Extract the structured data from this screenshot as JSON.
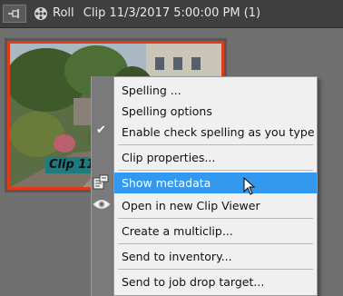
{
  "window": {
    "tab": "Roll",
    "clip_title": "Clip 11/3/2017 5:00:00 PM (1)"
  },
  "clip": {
    "caption": "Clip 11/3"
  },
  "context_menu": {
    "items": [
      {
        "label": "Spelling ..."
      },
      {
        "label": "Spelling options"
      },
      {
        "label": "Enable check spelling as you type",
        "checked": true
      },
      {
        "label": "Clip properties..."
      },
      {
        "label": "Show metadata",
        "highlighted": true,
        "icon": "metadata-icon"
      },
      {
        "label": "Open in new Clip Viewer",
        "icon": "eye-icon"
      },
      {
        "label": "Create a multiclip..."
      },
      {
        "label": "Send to inventory..."
      },
      {
        "label": "Send to job drop target..."
      }
    ]
  },
  "colors": {
    "selection_border": "#e23a16",
    "highlight": "#3399ee",
    "caption_bg": "#1e7b80"
  }
}
